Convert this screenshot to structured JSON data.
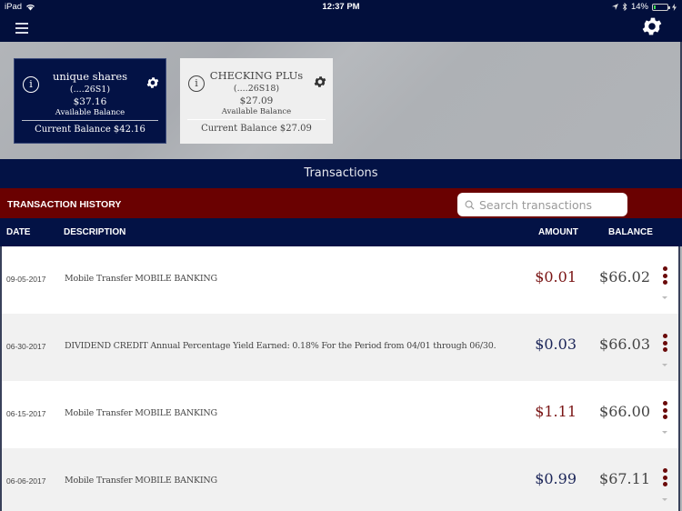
{
  "status_bar": {
    "device": "iPad",
    "time": "12:37 PM",
    "battery_percent": "14%",
    "battery_level": 0.14
  },
  "nav": {
    "menu_icon": "hamburger-icon",
    "settings_icon": "gear-icon"
  },
  "accounts": [
    {
      "name": "unique shares",
      "number": "(....26S1)",
      "available_balance": "$37.16",
      "available_label": "Available Balance",
      "current_balance": "Current Balance $42.16",
      "selected": true
    },
    {
      "name": "CHECKING PLUs",
      "number": "(....26S18)",
      "available_balance": "$27.09",
      "available_label": "Available Balance",
      "current_balance": "Current Balance $27.09",
      "selected": false
    }
  ],
  "section_title": "Transactions",
  "history": {
    "label": "TRANSACTION HISTORY",
    "search_placeholder": "Search transactions"
  },
  "columns": {
    "date": "DATE",
    "description": "DESCRIPTION",
    "amount": "AMOUNT",
    "balance": "BALANCE"
  },
  "transactions": [
    {
      "date": "09-05-2017",
      "description": "Mobile Transfer MOBILE BANKING",
      "amount": "$0.01",
      "type": "debit",
      "balance": "$66.02"
    },
    {
      "date": "06-30-2017",
      "description": "DIVIDEND CREDIT Annual Percentage Yield Earned: 0.18% For the Period from 04/01 through 06/30.",
      "amount": "$0.03",
      "type": "credit",
      "balance": "$66.03"
    },
    {
      "date": "06-15-2017",
      "description": "Mobile Transfer MOBILE BANKING",
      "amount": "$1.11",
      "type": "debit",
      "balance": "$66.00"
    },
    {
      "date": "06-06-2017",
      "description": "Mobile Transfer MOBILE BANKING",
      "amount": "$0.99",
      "type": "credit",
      "balance": "$67.11"
    }
  ],
  "colors": {
    "navy": "#031245",
    "maroon": "#6a0101",
    "debit": "#7a1515",
    "credit": "#1b2558"
  }
}
